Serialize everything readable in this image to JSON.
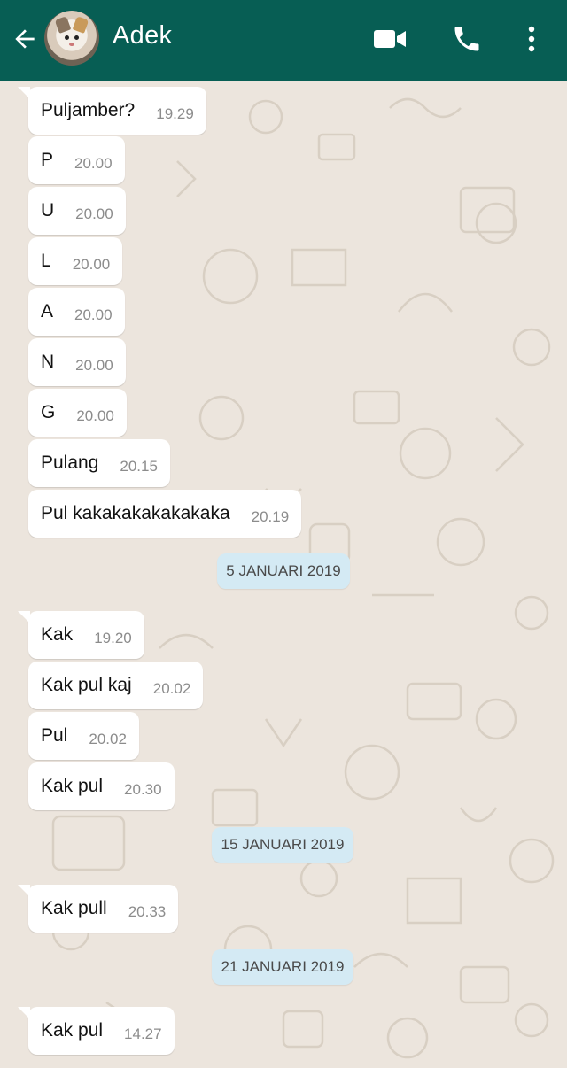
{
  "header": {
    "contact_name": "Adek",
    "bg_color": "#075e54",
    "icons": [
      "back-arrow-icon",
      "video-call-icon",
      "phone-call-icon",
      "more-options-icon"
    ]
  },
  "chat": {
    "background_color": "#ece5dd",
    "messages": [
      {
        "text": "Puljamber?",
        "time": "19.29"
      },
      {
        "text": "P",
        "time": "20.00"
      },
      {
        "text": "U",
        "time": "20.00"
      },
      {
        "text": "L",
        "time": "20.00"
      },
      {
        "text": "A",
        "time": "20.00"
      },
      {
        "text": "N",
        "time": "20.00"
      },
      {
        "text": "G",
        "time": "20.00"
      },
      {
        "text": "Pulang",
        "time": "20.15"
      },
      {
        "text": "Pul kakakakakakakaka",
        "time": "20.19"
      },
      {
        "date": "5 JANUARI 2019"
      },
      {
        "text": "Kak",
        "time": "19.20"
      },
      {
        "text": "Kak pul kaj",
        "time": "20.02"
      },
      {
        "text": "Pul",
        "time": "20.02"
      },
      {
        "text": "Kak pul",
        "time": "20.30"
      },
      {
        "date": "15 JANUARI 2019"
      },
      {
        "text": "Kak pull",
        "time": "20.33"
      },
      {
        "date": "21 JANUARI 2019"
      },
      {
        "text": "Kak pul",
        "time": "14.27"
      }
    ]
  }
}
